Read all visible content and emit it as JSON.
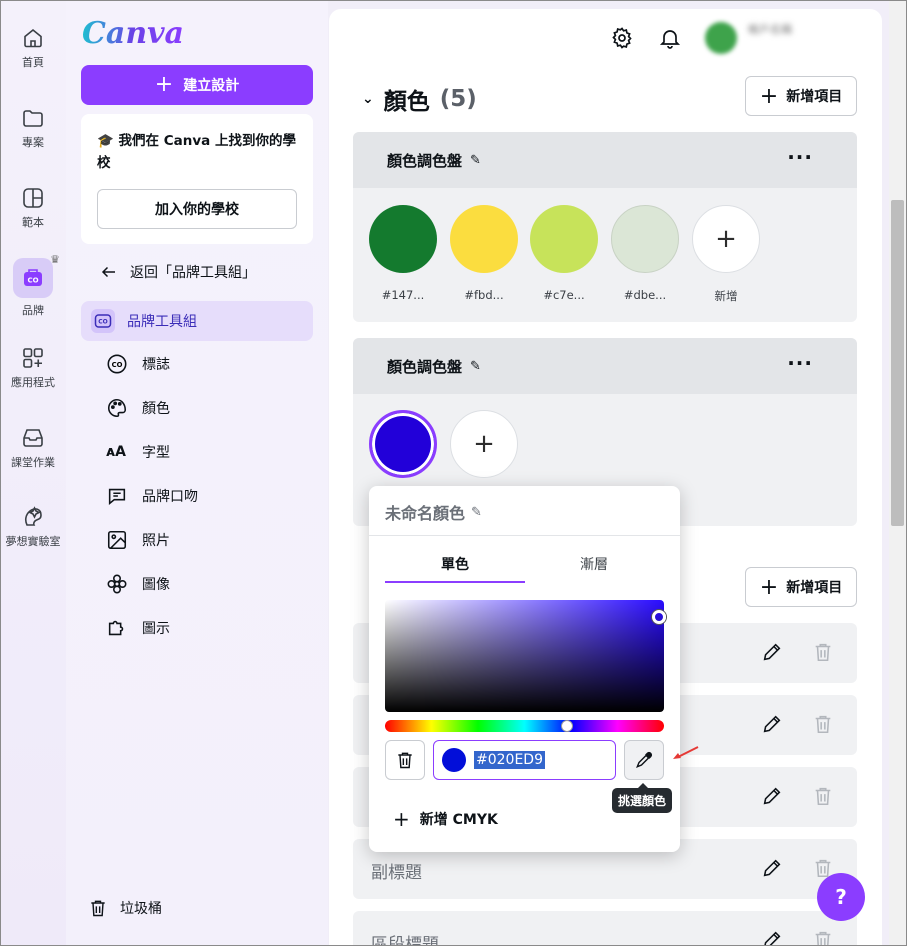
{
  "rail": {
    "items": [
      {
        "label": "首頁",
        "icon": "home-icon"
      },
      {
        "label": "專案",
        "icon": "folder-icon"
      },
      {
        "label": "範本",
        "icon": "template-icon"
      },
      {
        "label": "品牌",
        "icon": "brand-icon"
      },
      {
        "label": "應用程式",
        "icon": "apps-icon"
      },
      {
        "label": "課堂作業",
        "icon": "assignment-icon"
      },
      {
        "label": "夢想實驗室",
        "icon": "dream-lab-icon"
      }
    ]
  },
  "panel": {
    "logo": "Canva",
    "create_label": "建立設計",
    "school_text": "我們在 Canva 上找到你的學校",
    "school_button": "加入你的學校",
    "back_label": "返回「品牌工具組」",
    "active_label": "品牌工具組",
    "sub_items": [
      "標誌",
      "顏色",
      "字型",
      "品牌口吻",
      "照片",
      "圖像",
      "圖示"
    ],
    "trash_label": "垃圾桶"
  },
  "main": {
    "account_blurred": "帳戶名稱",
    "section_title": "顏色",
    "section_count": "(5)",
    "add_item_label": "新增項目",
    "palette1": {
      "title": "顏色調色盤",
      "swatches": [
        {
          "color": "#147a2e",
          "label": "#147..."
        },
        {
          "color": "#fbdd3f",
          "label": "#fbd..."
        },
        {
          "color": "#c7e35a",
          "label": "#c7e..."
        },
        {
          "color": "#dbe6d6",
          "label": "#dbe..."
        }
      ],
      "add_label": "新增"
    },
    "palette2": {
      "title": "顏色調色盤",
      "swatch_color": "#2200d9"
    },
    "add_item_label_2": "新增項目",
    "rows": [
      "",
      "",
      "",
      "副標題",
      "區段標題"
    ]
  },
  "popup": {
    "title": "未命名顏色",
    "tab_solid": "單色",
    "tab_gradient": "漸層",
    "hex_value": "#020ED9",
    "add_cmyk": "新增 CMYK",
    "tooltip": "挑選顏色"
  },
  "help_label": "?"
}
